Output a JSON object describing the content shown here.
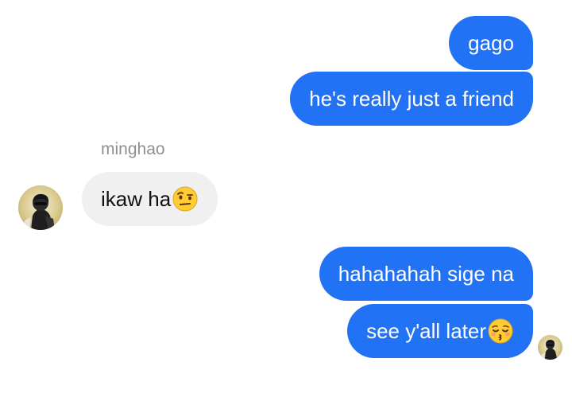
{
  "conversation": {
    "messages": [
      {
        "text": "gago",
        "side": "outgoing"
      },
      {
        "text": "he's really just a friend",
        "side": "outgoing"
      },
      {
        "text": "ikaw ha",
        "side": "incoming",
        "emoji": "face-with-raised-eyebrow"
      },
      {
        "text": "hahahahah sige na",
        "side": "outgoing"
      },
      {
        "text": "see y'all later",
        "side": "outgoing",
        "emoji": "kissing-face-with-closed-eyes"
      }
    ],
    "sender_name": "minghao"
  },
  "colors": {
    "outgoing_bubble": "#2272f6",
    "incoming_bubble": "#f0f0f0",
    "sender_label": "#8e8e93"
  }
}
